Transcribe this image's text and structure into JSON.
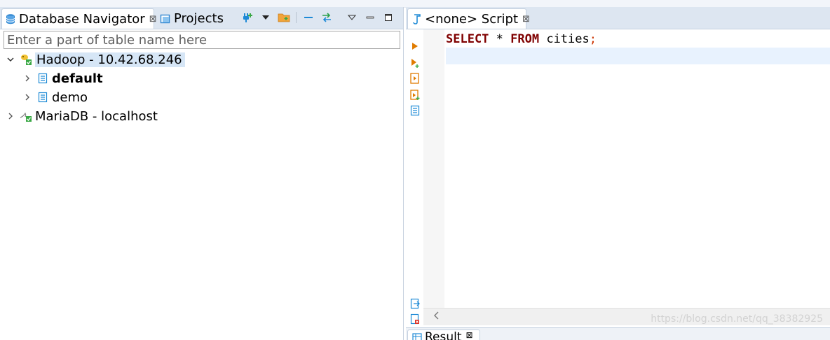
{
  "left_panel": {
    "tabs": [
      {
        "label": "Database Navigator",
        "close": "⊠"
      },
      {
        "label": "Projects"
      }
    ],
    "search": {
      "placeholder": "Enter a part of table name here",
      "value": ""
    },
    "tree": [
      {
        "label": "Hadoop - 10.42.68.246",
        "expanded": true,
        "selected": true
      },
      {
        "label": "default",
        "bold": true
      },
      {
        "label": "demo"
      },
      {
        "label": "MariaDB - localhost"
      }
    ]
  },
  "editor": {
    "tab": {
      "label": "<none> Script",
      "close": "⊠"
    },
    "code_tokens": {
      "select": "SELECT",
      "star": " * ",
      "from": "FROM",
      "table": " cities",
      "semi": ";"
    },
    "result_tab": {
      "label": "Result",
      "close": "⊠"
    }
  },
  "watermark": "https://blog.csdn.net/qq_38382925",
  "colors": {
    "tabbar": "#dde6f1",
    "selection": "#d6e6f6",
    "keyword": "#7f0000",
    "current_line": "#e8f2fe",
    "accent_orange": "#e07b00",
    "accent_blue": "#1e8ad6"
  }
}
